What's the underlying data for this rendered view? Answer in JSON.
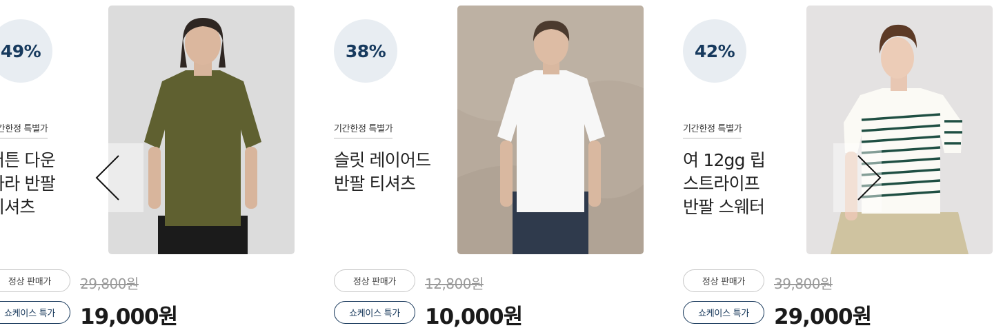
{
  "products": [
    {
      "discount": "49%",
      "tag": "기간한정 특별가",
      "name_lines": [
        "버튼 다운",
        "카라 반팔",
        "티셔츠"
      ],
      "regular_label": "정상 판매가",
      "regular_price": "29,800원",
      "special_label": "쇼케이스 특가",
      "special_price": "19,000원",
      "photo": {
        "background": "#dcdcdc",
        "shirt_color": "#5f6030",
        "pants_color": "#1b1b1b",
        "subject": "male model in olive polo shirt"
      }
    },
    {
      "discount": "38%",
      "tag": "기간한정 특별가",
      "name_lines": [
        "슬릿 레이어드",
        "반팔 티셔츠"
      ],
      "regular_label": "정상 판매가",
      "regular_price": "12,800원",
      "special_label": "쇼케이스 특가",
      "special_price": "10,000원",
      "photo": {
        "background": "#b7aa9c",
        "shirt_color": "#f7f7f7",
        "pants_color": "#2f3a4c",
        "subject": "male model in white t-shirt and jeans"
      }
    },
    {
      "discount": "42%",
      "tag": "기간한정 특별가",
      "name_lines": [
        "여 12gg 립",
        "스트라이프",
        "반팔 스웨터"
      ],
      "regular_label": "정상 판매가",
      "regular_price": "39,800원",
      "special_label": "쇼케이스 특가",
      "special_price": "29,000원",
      "photo": {
        "background": "#e4e2e2",
        "shirt_color": "#fbfaf5",
        "stripe_color": "#1f4f43",
        "pants_color": "#cfc3a0",
        "subject": "female model in striped knit top"
      }
    }
  ],
  "carousel": {
    "prev_icon": "chevron-left-icon",
    "next_icon": "chevron-right-icon"
  },
  "colors": {
    "badge_bg": "#e8edf2",
    "badge_text": "#173a5e",
    "accent_border": "#16375a"
  }
}
